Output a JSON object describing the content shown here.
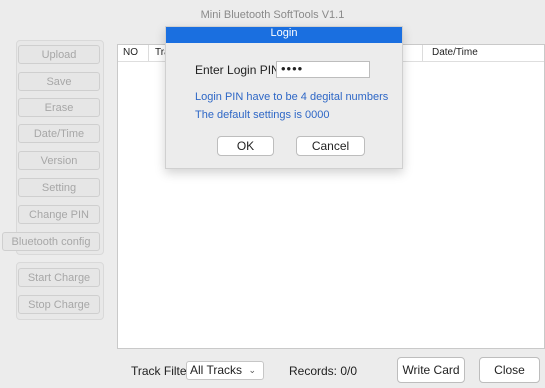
{
  "window": {
    "title": "Mini Bluetooth SoftTools V1.1"
  },
  "sidebar": {
    "buttons": [
      "Upload",
      "Save",
      "Erase",
      "Date/Time",
      "Version",
      "Setting",
      "Change PIN",
      "Bluetooth config"
    ],
    "charge_buttons": [
      "Start Charge",
      "Stop Charge"
    ]
  },
  "list": {
    "columns": [
      "NO",
      "Tra",
      "Date/Time"
    ]
  },
  "bottom": {
    "track_filter_label": "Track Filter",
    "track_filter_value": "All Tracks",
    "records_label": "Records: 0/0",
    "write_card": "Write Card",
    "close": "Close"
  },
  "dialog": {
    "title": "Login",
    "pin_label": "Enter Login PIN:",
    "pin_value": "••••",
    "info_line1": "Login PIN have to be 4 degital numbers",
    "info_line2": "The default settings is 0000",
    "ok": "OK",
    "cancel": "Cancel"
  },
  "colors": {
    "dialog_title_bg": "#1a6fe0",
    "info_text": "#2e67c6"
  }
}
